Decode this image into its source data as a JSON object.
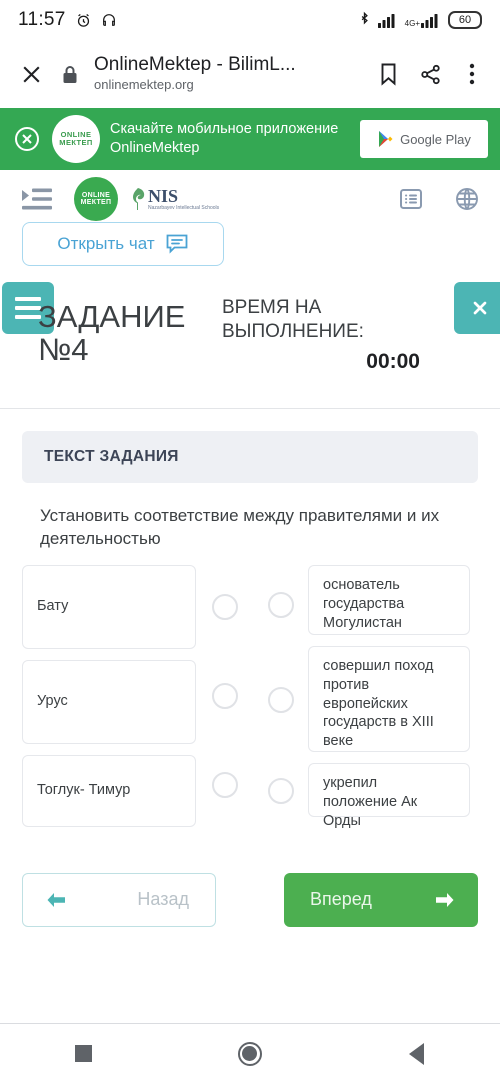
{
  "status_bar": {
    "time": "11:57",
    "alarm_icon": "alarm-icon",
    "headphone_icon": "headphone-icon",
    "bluetooth_icon": "bluetooth-icon",
    "network_label": "4G+",
    "battery_level": "60"
  },
  "browser_bar": {
    "close_icon": "close-icon",
    "lock_icon": "lock-icon",
    "title": "OnlineMektep - BilimL...",
    "url": "onlinemektep.org",
    "bookmark_icon": "bookmark-icon",
    "share_icon": "share-icon",
    "more_icon": "more-vertical-icon"
  },
  "app_banner": {
    "close_icon": "close-circle-icon",
    "logo_line1": "ONLINE",
    "logo_line2": "МЕКТЕП",
    "text": "Скачайте мобильное приложение OnlineMektep",
    "store_button": "Google Play",
    "background_color": "#34a853"
  },
  "site_header": {
    "menu_icon": "menu-indent-icon",
    "logo_om_line1": "ONLINE",
    "logo_om_line2": "МЕКТЕП",
    "logo_nis_main": "NIS",
    "logo_nis_sub": "Nazarbayev Intellectual Schools",
    "list_icon": "list-icon",
    "globe_icon": "globe-icon"
  },
  "chat": {
    "label": "Открыть чат",
    "icon": "chat-bubble-icon"
  },
  "task_header": {
    "burger_icon": "hamburger-menu-icon",
    "close_icon": "close-icon",
    "title": "ЗАДАНИЕ №4",
    "timer_label": "ВРЕМЯ НА ВЫПОЛНЕНИЕ:",
    "timer_value": "00:00",
    "accent_color": "#4cb5b4"
  },
  "task": {
    "banner_label": "ТЕКСТ ЗАДАНИЯ",
    "prompt": "Установить соответствие между правителями и их деятельностью",
    "left_items": [
      {
        "label": "Бату"
      },
      {
        "label": "Урус"
      },
      {
        "label": "Тоглук- Тимур"
      }
    ],
    "right_items": [
      {
        "label": "основатель государства Могулистан"
      },
      {
        "label": "совершил поход против европейских государств в XIII веке"
      },
      {
        "label": "укрепил положение Ак Орды"
      }
    ]
  },
  "nav": {
    "back_label": "Назад",
    "back_icon": "arrow-left-icon",
    "next_label": "Вперед",
    "next_icon": "arrow-right-icon",
    "next_color": "#4caf50"
  },
  "android_nav": {
    "recents_icon": "square-recents-icon",
    "home_icon": "circle-home-icon",
    "back_icon": "triangle-back-icon"
  }
}
